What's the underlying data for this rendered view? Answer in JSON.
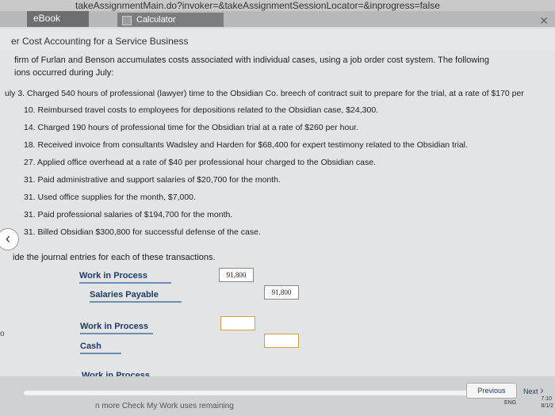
{
  "browser": {
    "url_text": "takeAssignmentMain.do?invoker=&takeAssignmentSessionLocator=&inprogress=false",
    "tabs": [
      "eBook",
      "Calculator"
    ]
  },
  "page": {
    "title": "er Cost Accounting for a Service Business",
    "intro_line1": "firm of Furlan and Benson accumulates costs associated with individual cases, using a job order cost system. The following",
    "intro_line2": "ions occurred during July:",
    "transactions": [
      "uly 3. Charged 540 hours of professional (lawyer) time to the Obsidian Co. breech of contract suit to prepare for the trial, at a rate of $170 per",
      "10. Reimbursed travel costs to employees for depositions related to the Obsidian case, $24,300.",
      "14. Charged 190 hours of professional time for the Obsidian trial at a rate of $260 per hour.",
      "18. Received invoice from consultants Wadsley and Harden for $68,400 for expert testimony related to the Obsidian trial.",
      "27. Applied office overhead at a rate of $40 per professional hour charged to the Obsidian case.",
      "31. Paid administrative and support salaries of $20,700 for the month.",
      "31. Used office supplies for the month, $7,000.",
      "31. Paid professional salaries of $194,700 for the month.",
      "31. Billed Obsidian $300,800 for successful defense of the case."
    ],
    "instructions": "ide the journal entries for each of these transactions.",
    "marker": "o"
  },
  "journal": [
    {
      "account": "Work in Process",
      "debit": "91,800",
      "credit": ""
    },
    {
      "account": "Salaries Payable",
      "debit": "",
      "credit": "91,800"
    },
    {
      "account": "Work in Process",
      "debit": "",
      "credit": ""
    },
    {
      "account": "Cash",
      "debit": "",
      "credit": ""
    },
    {
      "account": "Work in Process",
      "debit": "",
      "credit": ""
    }
  ],
  "footer": {
    "remaining_text": "n more Check My Work uses remaining",
    "previous_label": "Previous",
    "next_label": "Next",
    "tray_lang": "ENG",
    "clock_time": "7:10",
    "clock_date": "8/1/2"
  },
  "icons": [
    "calculator-icon",
    "back-chevron-icon",
    "next-chevron-icon",
    "close-icon"
  ]
}
